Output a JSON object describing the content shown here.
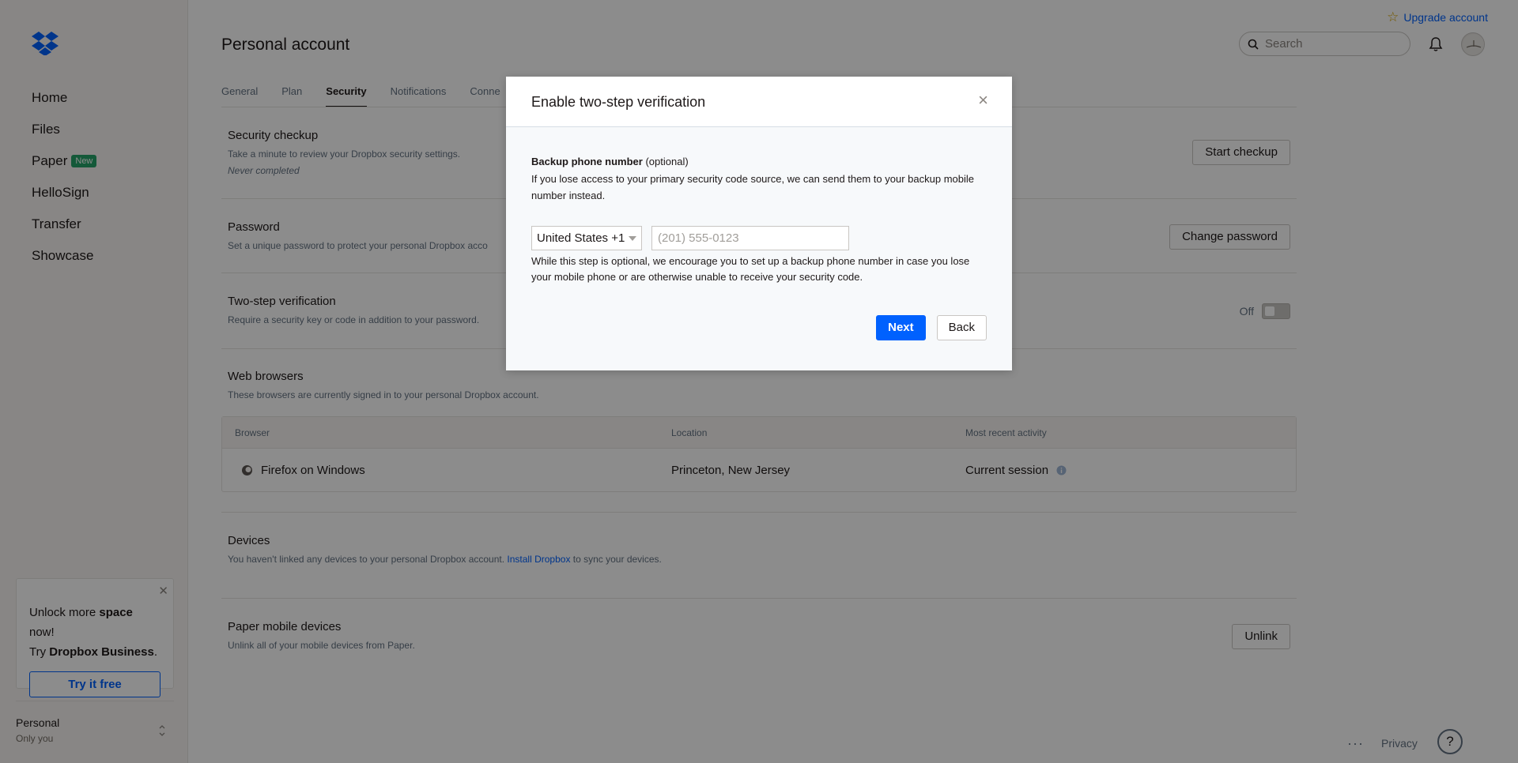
{
  "header": {
    "upgrade_label": "Upgrade account",
    "page_title": "Personal account",
    "search_placeholder": "Search"
  },
  "sidebar": {
    "items": [
      {
        "label": "Home"
      },
      {
        "label": "Files"
      },
      {
        "label": "Paper",
        "badge": "New"
      },
      {
        "label": "HelloSign"
      },
      {
        "label": "Transfer"
      },
      {
        "label": "Showcase"
      }
    ],
    "promo": {
      "line1_pre": "Unlock more ",
      "line1_bold": "space",
      "line1_post": " now!",
      "line2_pre": "Try ",
      "line2_bold": "Dropbox Business",
      "line2_post": ".",
      "button": "Try it free",
      "close": "✕"
    },
    "account": {
      "name": "Personal",
      "sub": "Only you"
    }
  },
  "tabs": [
    {
      "label": "General"
    },
    {
      "label": "Plan"
    },
    {
      "label": "Security",
      "active": true
    },
    {
      "label": "Notifications"
    },
    {
      "label": "Conne"
    }
  ],
  "sections": {
    "security_checkup": {
      "title": "Security checkup",
      "desc": "Take a minute to review your Dropbox security settings.",
      "note": "Never completed",
      "button": "Start checkup"
    },
    "password": {
      "title": "Password",
      "desc": "Set a unique password to protect your personal Dropbox acco",
      "button": "Change password"
    },
    "two_step": {
      "title": "Two-step verification",
      "desc": "Require a security key or code in addition to your password.",
      "toggle_label": "Off"
    },
    "web_browsers": {
      "title": "Web browsers",
      "desc": "These browsers are currently signed in to your personal Dropbox account.",
      "columns": [
        "Browser",
        "Location",
        "Most recent activity"
      ],
      "rows": [
        {
          "browser": "Firefox on Windows",
          "location": "Princeton, New Jersey",
          "activity": "Current session"
        }
      ]
    },
    "devices": {
      "title": "Devices",
      "desc_pre": "You haven't linked any devices to your personal Dropbox account. ",
      "link": "Install Dropbox",
      "desc_post": " to sync your devices."
    },
    "paper_devices": {
      "title": "Paper mobile devices",
      "desc": "Unlink all of your mobile devices from Paper.",
      "button": "Unlink"
    }
  },
  "footer": {
    "dots": "···",
    "privacy": "Privacy",
    "help": "?"
  },
  "modal": {
    "title": "Enable two-step verification",
    "close": "×",
    "field_title": "Backup phone number",
    "field_optional": " (optional)",
    "field_help": "If you lose access to your primary security code source, we can send them to your backup mobile number instead.",
    "country_value": "United States +1",
    "phone_placeholder": "(201) 555-0123",
    "phone_value": "",
    "phone_note": "While this step is optional, we encourage you to set up a backup phone number in case you lose your mobile phone or are otherwise unable to receive your security code.",
    "next_label": "Next",
    "back_label": "Back"
  },
  "colors": {
    "accent": "#0061fe",
    "overlay": "rgba(0,0,0,0.45)",
    "badge": "#26a269"
  }
}
